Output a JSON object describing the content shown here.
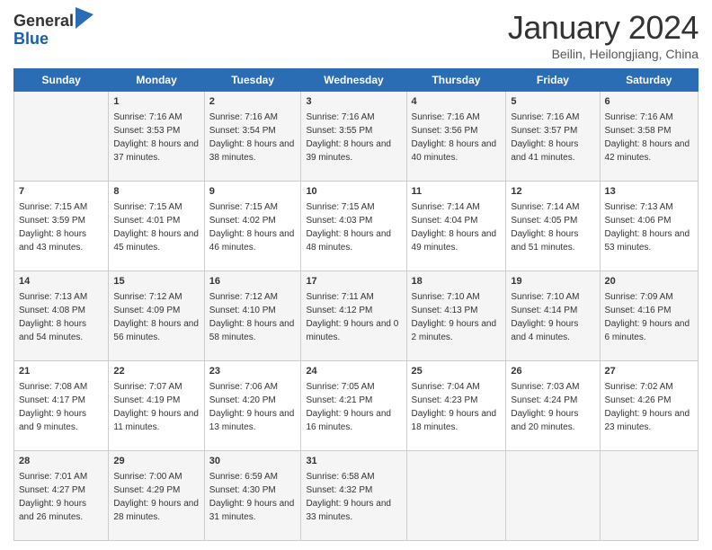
{
  "logo": {
    "general": "General",
    "blue": "Blue"
  },
  "title": "January 2024",
  "subtitle": "Beilin, Heilongjiang, China",
  "days": [
    "Sunday",
    "Monday",
    "Tuesday",
    "Wednesday",
    "Thursday",
    "Friday",
    "Saturday"
  ],
  "weeks": [
    [
      {
        "num": "",
        "sunrise": "",
        "sunset": "",
        "daylight": ""
      },
      {
        "num": "1",
        "sunrise": "Sunrise: 7:16 AM",
        "sunset": "Sunset: 3:53 PM",
        "daylight": "Daylight: 8 hours and 37 minutes."
      },
      {
        "num": "2",
        "sunrise": "Sunrise: 7:16 AM",
        "sunset": "Sunset: 3:54 PM",
        "daylight": "Daylight: 8 hours and 38 minutes."
      },
      {
        "num": "3",
        "sunrise": "Sunrise: 7:16 AM",
        "sunset": "Sunset: 3:55 PM",
        "daylight": "Daylight: 8 hours and 39 minutes."
      },
      {
        "num": "4",
        "sunrise": "Sunrise: 7:16 AM",
        "sunset": "Sunset: 3:56 PM",
        "daylight": "Daylight: 8 hours and 40 minutes."
      },
      {
        "num": "5",
        "sunrise": "Sunrise: 7:16 AM",
        "sunset": "Sunset: 3:57 PM",
        "daylight": "Daylight: 8 hours and 41 minutes."
      },
      {
        "num": "6",
        "sunrise": "Sunrise: 7:16 AM",
        "sunset": "Sunset: 3:58 PM",
        "daylight": "Daylight: 8 hours and 42 minutes."
      }
    ],
    [
      {
        "num": "7",
        "sunrise": "Sunrise: 7:15 AM",
        "sunset": "Sunset: 3:59 PM",
        "daylight": "Daylight: 8 hours and 43 minutes."
      },
      {
        "num": "8",
        "sunrise": "Sunrise: 7:15 AM",
        "sunset": "Sunset: 4:01 PM",
        "daylight": "Daylight: 8 hours and 45 minutes."
      },
      {
        "num": "9",
        "sunrise": "Sunrise: 7:15 AM",
        "sunset": "Sunset: 4:02 PM",
        "daylight": "Daylight: 8 hours and 46 minutes."
      },
      {
        "num": "10",
        "sunrise": "Sunrise: 7:15 AM",
        "sunset": "Sunset: 4:03 PM",
        "daylight": "Daylight: 8 hours and 48 minutes."
      },
      {
        "num": "11",
        "sunrise": "Sunrise: 7:14 AM",
        "sunset": "Sunset: 4:04 PM",
        "daylight": "Daylight: 8 hours and 49 minutes."
      },
      {
        "num": "12",
        "sunrise": "Sunrise: 7:14 AM",
        "sunset": "Sunset: 4:05 PM",
        "daylight": "Daylight: 8 hours and 51 minutes."
      },
      {
        "num": "13",
        "sunrise": "Sunrise: 7:13 AM",
        "sunset": "Sunset: 4:06 PM",
        "daylight": "Daylight: 8 hours and 53 minutes."
      }
    ],
    [
      {
        "num": "14",
        "sunrise": "Sunrise: 7:13 AM",
        "sunset": "Sunset: 4:08 PM",
        "daylight": "Daylight: 8 hours and 54 minutes."
      },
      {
        "num": "15",
        "sunrise": "Sunrise: 7:12 AM",
        "sunset": "Sunset: 4:09 PM",
        "daylight": "Daylight: 8 hours and 56 minutes."
      },
      {
        "num": "16",
        "sunrise": "Sunrise: 7:12 AM",
        "sunset": "Sunset: 4:10 PM",
        "daylight": "Daylight: 8 hours and 58 minutes."
      },
      {
        "num": "17",
        "sunrise": "Sunrise: 7:11 AM",
        "sunset": "Sunset: 4:12 PM",
        "daylight": "Daylight: 9 hours and 0 minutes."
      },
      {
        "num": "18",
        "sunrise": "Sunrise: 7:10 AM",
        "sunset": "Sunset: 4:13 PM",
        "daylight": "Daylight: 9 hours and 2 minutes."
      },
      {
        "num": "19",
        "sunrise": "Sunrise: 7:10 AM",
        "sunset": "Sunset: 4:14 PM",
        "daylight": "Daylight: 9 hours and 4 minutes."
      },
      {
        "num": "20",
        "sunrise": "Sunrise: 7:09 AM",
        "sunset": "Sunset: 4:16 PM",
        "daylight": "Daylight: 9 hours and 6 minutes."
      }
    ],
    [
      {
        "num": "21",
        "sunrise": "Sunrise: 7:08 AM",
        "sunset": "Sunset: 4:17 PM",
        "daylight": "Daylight: 9 hours and 9 minutes."
      },
      {
        "num": "22",
        "sunrise": "Sunrise: 7:07 AM",
        "sunset": "Sunset: 4:19 PM",
        "daylight": "Daylight: 9 hours and 11 minutes."
      },
      {
        "num": "23",
        "sunrise": "Sunrise: 7:06 AM",
        "sunset": "Sunset: 4:20 PM",
        "daylight": "Daylight: 9 hours and 13 minutes."
      },
      {
        "num": "24",
        "sunrise": "Sunrise: 7:05 AM",
        "sunset": "Sunset: 4:21 PM",
        "daylight": "Daylight: 9 hours and 16 minutes."
      },
      {
        "num": "25",
        "sunrise": "Sunrise: 7:04 AM",
        "sunset": "Sunset: 4:23 PM",
        "daylight": "Daylight: 9 hours and 18 minutes."
      },
      {
        "num": "26",
        "sunrise": "Sunrise: 7:03 AM",
        "sunset": "Sunset: 4:24 PM",
        "daylight": "Daylight: 9 hours and 20 minutes."
      },
      {
        "num": "27",
        "sunrise": "Sunrise: 7:02 AM",
        "sunset": "Sunset: 4:26 PM",
        "daylight": "Daylight: 9 hours and 23 minutes."
      }
    ],
    [
      {
        "num": "28",
        "sunrise": "Sunrise: 7:01 AM",
        "sunset": "Sunset: 4:27 PM",
        "daylight": "Daylight: 9 hours and 26 minutes."
      },
      {
        "num": "29",
        "sunrise": "Sunrise: 7:00 AM",
        "sunset": "Sunset: 4:29 PM",
        "daylight": "Daylight: 9 hours and 28 minutes."
      },
      {
        "num": "30",
        "sunrise": "Sunrise: 6:59 AM",
        "sunset": "Sunset: 4:30 PM",
        "daylight": "Daylight: 9 hours and 31 minutes."
      },
      {
        "num": "31",
        "sunrise": "Sunrise: 6:58 AM",
        "sunset": "Sunset: 4:32 PM",
        "daylight": "Daylight: 9 hours and 33 minutes."
      },
      {
        "num": "",
        "sunrise": "",
        "sunset": "",
        "daylight": ""
      },
      {
        "num": "",
        "sunrise": "",
        "sunset": "",
        "daylight": ""
      },
      {
        "num": "",
        "sunrise": "",
        "sunset": "",
        "daylight": ""
      }
    ]
  ]
}
